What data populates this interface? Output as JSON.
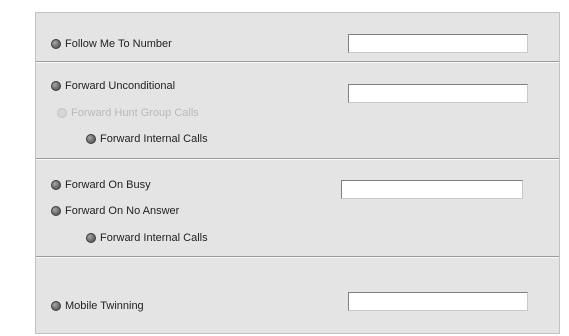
{
  "sections": {
    "follow_me": {
      "label": "Follow Me To Number",
      "value": ""
    },
    "forward_unconditional": {
      "label": "Forward Unconditional",
      "value": "",
      "hunt_group_label": "Forward Hunt Group Calls",
      "internal_label": "Forward Internal Calls"
    },
    "forward_busy_noanswer": {
      "busy_label": "Forward On Busy",
      "value": "",
      "no_answer_label": "Forward On No Answer",
      "internal_label": "Forward Internal Calls"
    },
    "mobile_twinning": {
      "label": "Mobile Twinning",
      "value": ""
    }
  }
}
